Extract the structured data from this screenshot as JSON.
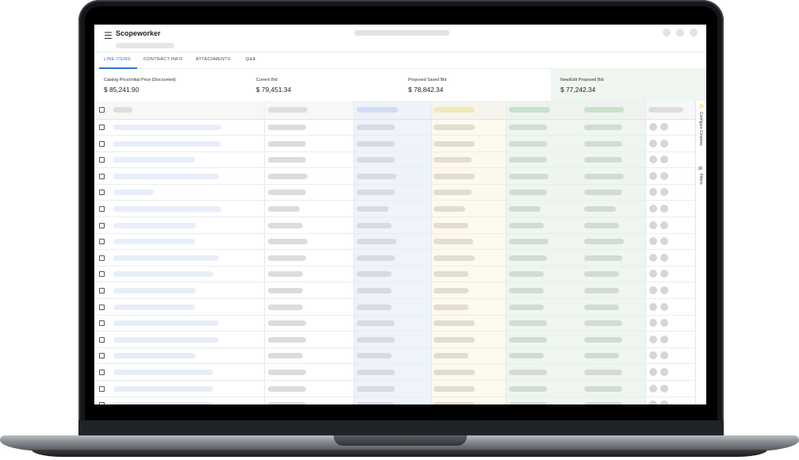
{
  "app": {
    "brand": "Scopeworker",
    "menu_icon": "hamburger-icon"
  },
  "tabs": [
    {
      "label": "LINE ITEMS",
      "active": true
    },
    {
      "label": "CONTRACT INFO",
      "active": false
    },
    {
      "label": "ATTACHMENTS",
      "active": false
    },
    {
      "label": "Q&A",
      "active": false
    }
  ],
  "summary": [
    {
      "label": "Catalog Price/Initial Price (Discounted)",
      "value": "$ 85,241.90"
    },
    {
      "label": "Current Bid",
      "value": "$ 79,451.34"
    },
    {
      "label": "Proposed Saved Bid",
      "value": "$ 78,842.34"
    },
    {
      "label": "New/Edit Proposed Bid",
      "value": "$ 77,242.34"
    }
  ],
  "side_panel": {
    "configure_label": "Configure Columns",
    "filters_label": "Filters"
  },
  "colors": {
    "accent": "#2b72d4",
    "blue_col": "#eef3fc",
    "yellow_col": "#fdf9ee",
    "green_col": "#eef6ef"
  },
  "grid": {
    "row_count": 18
  }
}
